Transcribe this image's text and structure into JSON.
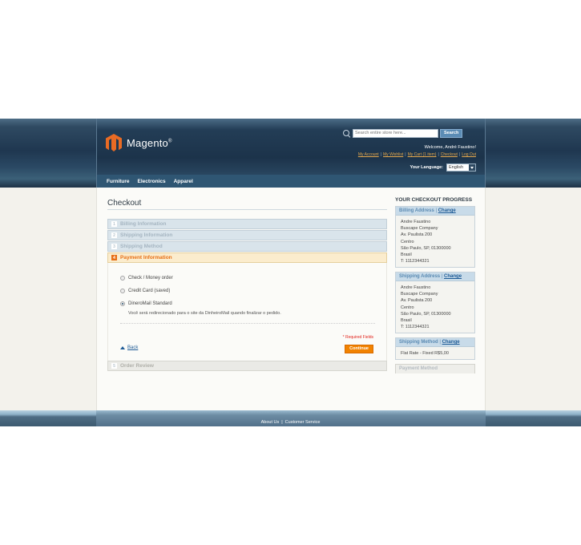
{
  "header": {
    "logo_text": "Magento",
    "logo_reg": "®",
    "search_placeholder": "Search entire store here...",
    "search_button": "Search",
    "welcome": "Welcome, André Faustino!",
    "quick_links": [
      "My Account",
      "My Wishlist",
      "My Cart (1 item)",
      "Checkout",
      "Log Out"
    ],
    "language_label": "Your Language:",
    "language_value": "English"
  },
  "nav": [
    "Furniture",
    "Electronics",
    "Apparel"
  ],
  "checkout": {
    "title": "Checkout",
    "steps": [
      {
        "num": "1",
        "label": "Billing Information"
      },
      {
        "num": "2",
        "label": "Shipping Information"
      },
      {
        "num": "3",
        "label": "Shipping Method"
      },
      {
        "num": "4",
        "label": "Payment Information"
      },
      {
        "num": "5",
        "label": "Order Review"
      }
    ],
    "payment_options": [
      {
        "label": "Check / Money order",
        "checked": false
      },
      {
        "label": "Credit Card (saved)",
        "checked": false
      },
      {
        "label": "DineroMail Standard",
        "checked": true
      }
    ],
    "redirect_note": "Você será redirecionado para o site da DinheiroMail quando finalizar o pedido.",
    "required_fields": "* Required Fields",
    "back_label": "Back",
    "continue_label": "Continue"
  },
  "progress": {
    "title": "Your Checkout Progress",
    "change_label": "Change",
    "billing": {
      "label": "Billing Address",
      "lines": [
        "Andre Faustino",
        "Buscape Company",
        "Av. Paulista 200",
        "Centro",
        "São Paulo, SP, 01300000",
        "Brasil",
        "T: 1112344321"
      ]
    },
    "shipping": {
      "label": "Shipping Address",
      "lines": [
        "Andre Faustino",
        "Buscape Company",
        "Av. Paulista 200",
        "Centro",
        "São Paulo, SP, 01300000",
        "Brasil",
        "T: 1112344321"
      ]
    },
    "method": {
      "label": "Shipping Method",
      "lines": [
        "Flat Rate - Fixed R$5,00"
      ]
    },
    "payment": {
      "label": "Payment Method"
    }
  },
  "footer": {
    "links": [
      "About Us",
      "Customer Service"
    ]
  },
  "colors": {
    "accent": "#e76f16",
    "link": "#1e5b96",
    "header": "#1f3750"
  }
}
